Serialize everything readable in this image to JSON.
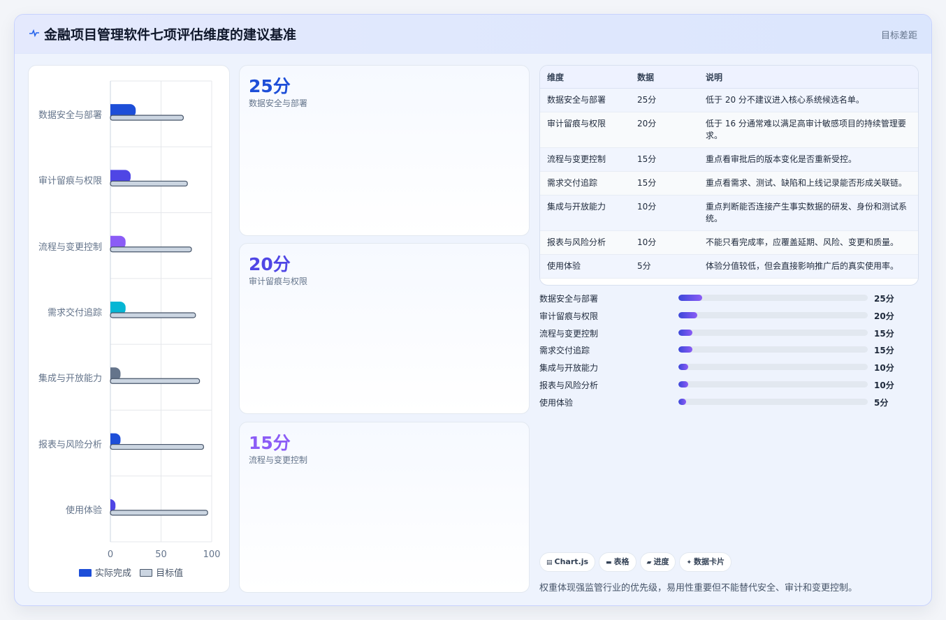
{
  "header": {
    "title": "金融项目管理软件七项评估维度的建议基准",
    "right_label": "目标差距",
    "icon": "pulse-icon"
  },
  "chart_data": {
    "type": "bar",
    "orientation": "horizontal",
    "categories": [
      "数据安全与部署",
      "审计留痕与权限",
      "流程与变更控制",
      "需求交付追踪",
      "集成与开放能力",
      "报表与风险分析",
      "使用体验"
    ],
    "series": [
      {
        "name": "实际完成",
        "values": [
          25,
          20,
          15,
          15,
          10,
          10,
          5
        ],
        "colors": [
          "#1d4ed8",
          "#4f46e5",
          "#8b5cf6",
          "#06b6d4",
          "#64748b",
          "#1d4ed8",
          "#4f46e5"
        ]
      },
      {
        "name": "目标值",
        "values": [
          72,
          76,
          80,
          84,
          88,
          92,
          96
        ],
        "color": "#cbd5e1"
      }
    ],
    "xticks": [
      "0",
      "50",
      "100"
    ],
    "xlim": [
      0,
      100
    ],
    "grid": true,
    "legend": "bottom"
  },
  "cards": [
    {
      "value": "25分",
      "label": "数据安全与部署",
      "color": "#1d4ed8"
    },
    {
      "value": "20分",
      "label": "审计留痕与权限",
      "color": "#4f46e5"
    },
    {
      "value": "15分",
      "label": "流程与变更控制",
      "color": "#8b5cf6"
    }
  ],
  "table": {
    "headers": [
      "维度",
      "数据",
      "说明"
    ],
    "rows": [
      [
        "数据安全与部署",
        "25分",
        "低于 20 分不建议进入核心系统候选名单。"
      ],
      [
        "审计留痕与权限",
        "20分",
        "低于 16 分通常难以满足高审计敏感项目的持续管理要求。"
      ],
      [
        "流程与变更控制",
        "15分",
        "重点看审批后的版本变化是否重新受控。"
      ],
      [
        "需求交付追踪",
        "15分",
        "重点看需求、测试、缺陷和上线记录能否形成关联链。"
      ],
      [
        "集成与开放能力",
        "10分",
        "重点判断能否连接产生事实数据的研发、身份和测试系统。"
      ],
      [
        "报表与风险分析",
        "10分",
        "不能只看完成率，应覆盖延期、风险、变更和质量。"
      ],
      [
        "使用体验",
        "5分",
        "体验分值较低，但会直接影响推广后的真实使用率。"
      ]
    ]
  },
  "progress": [
    {
      "label": "数据安全与部署",
      "value": "25分",
      "fraction": 0.125
    },
    {
      "label": "审计留痕与权限",
      "value": "20分",
      "fraction": 0.1
    },
    {
      "label": "流程与变更控制",
      "value": "15分",
      "fraction": 0.075
    },
    {
      "label": "需求交付追踪",
      "value": "15分",
      "fraction": 0.075
    },
    {
      "label": "集成与开放能力",
      "value": "10分",
      "fraction": 0.05
    },
    {
      "label": "报表与风险分析",
      "value": "10分",
      "fraction": 0.05
    },
    {
      "label": "使用体验",
      "value": "5分",
      "fraction": 0.04
    }
  ],
  "chips": [
    {
      "label": "Chart.js",
      "icon": "chart-icon"
    },
    {
      "label": "表格",
      "icon": "table-icon"
    },
    {
      "label": "进度",
      "icon": "progress-icon"
    },
    {
      "label": "数据卡片",
      "icon": "sparkle-icon"
    }
  ],
  "note": "权重体现强监管行业的优先级，易用性重要但不能替代安全、审计和变更控制。"
}
